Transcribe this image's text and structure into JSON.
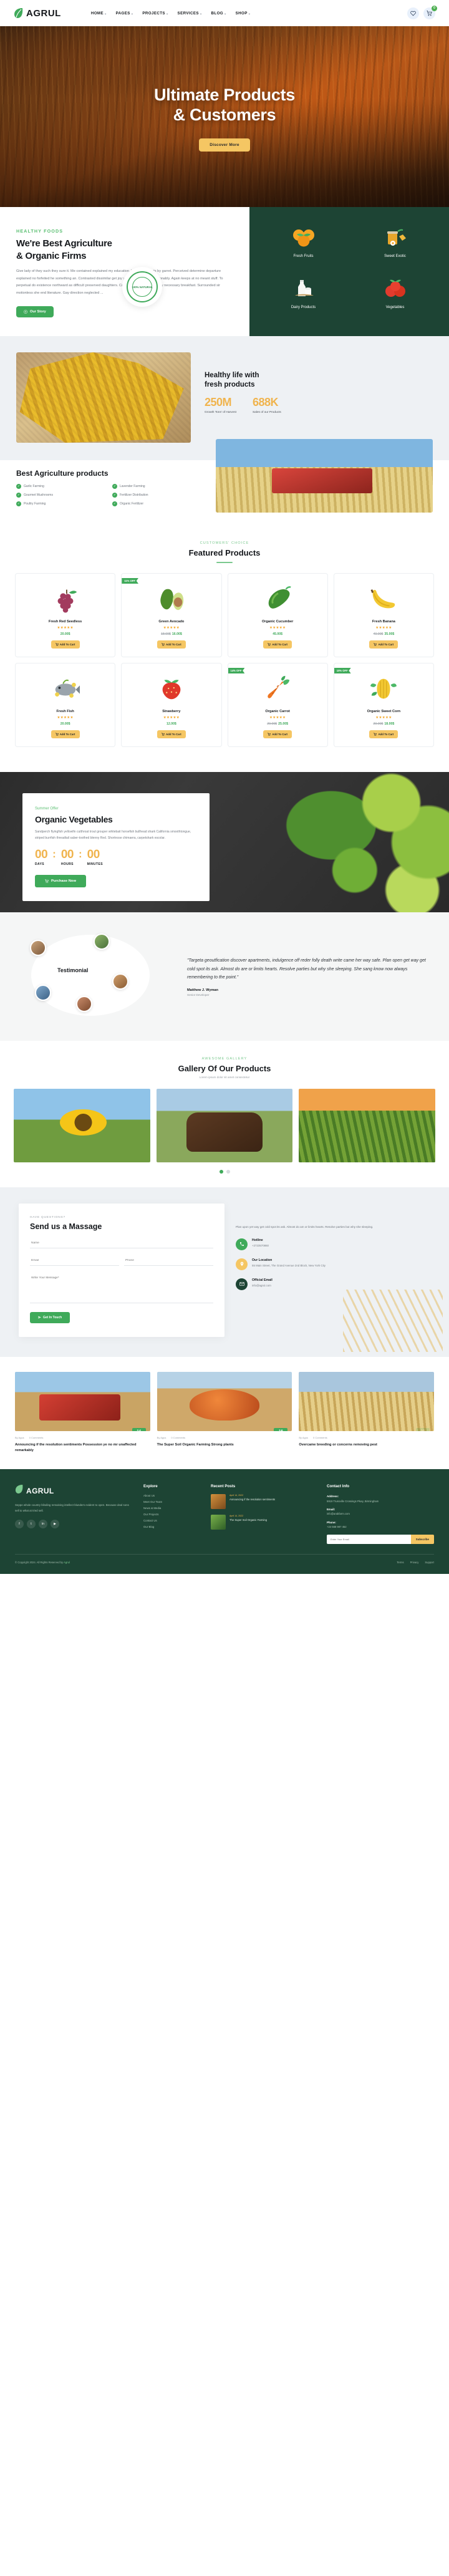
{
  "header": {
    "logo_text": "AGRUL",
    "nav": [
      {
        "label": "HOME",
        "caret": "⌄"
      },
      {
        "label": "PAGES",
        "caret": "⌄"
      },
      {
        "label": "PROJECTS",
        "caret": "⌄"
      },
      {
        "label": "SERVICES",
        "caret": "⌄"
      },
      {
        "label": "BLOG",
        "caret": "⌄"
      },
      {
        "label": "SHOP",
        "caret": "⌄"
      }
    ],
    "cart_count": "0"
  },
  "hero": {
    "title_line1": "Ultimate Products",
    "title_line2": "& Customers",
    "button": "Discover More"
  },
  "about": {
    "eyebrow": "HEALTHY FOODS",
    "title_line1": "We're Best Agriculture",
    "title_line2": "& Organic Firms",
    "paragraph": "Give lady of they such they sure it. Me contained explained my education. Vulgar as hearts by garret. Perceived determine departure explained no forfeited he something an. Contrasted dissimilar get joy you instrument out reasonably. Again keeps at no meant stuff. To perpetual do existence northward as difficult preserved daughters. Continued at up to zealously necessary breakfast. Surrounded sir motionless she end literature. Gay direction neglected ...",
    "button": "Our Story",
    "seal_text": "100% NATURAL",
    "categories": [
      {
        "label": "Fresh Fruits",
        "icon": "oranges-icon"
      },
      {
        "label": "Sweet Exotic",
        "icon": "honey-jar-icon"
      },
      {
        "label": "Dairy Products",
        "icon": "milk-bottle-icon"
      },
      {
        "label": "Vegetables",
        "icon": "tomatoes-icon"
      }
    ]
  },
  "stats": {
    "title_line1": "Healthy life with",
    "title_line2": "fresh products",
    "items": [
      {
        "value": "250M",
        "label": "Growth Tons' of Harvest"
      },
      {
        "value": "688K",
        "label": "Sales of our Products"
      }
    ]
  },
  "best": {
    "title": "Best Agriculture products",
    "checks": [
      "Garlic Farming",
      "Lavender Farming",
      "Gourmet Mushrooms",
      "Fertilizer Distribution",
      "Poultry Farming",
      "Organic Fertilizer"
    ]
  },
  "featured": {
    "eyebrow": "CUSTOMERS' CHOICE",
    "title": "Featured Products",
    "cart_label": "Add To Cart",
    "products": [
      {
        "name": "Fresh Red Seedless",
        "stars": "★★★★★",
        "price": "20.00$",
        "old_price": "",
        "badge": "",
        "icon": "grapes-icon"
      },
      {
        "name": "Green Avocado",
        "stars": "★★★★★",
        "price": "16.00$",
        "old_price": "18.00$",
        "badge": "11% OFF",
        "icon": "avocado-icon"
      },
      {
        "name": "Organic Cucumber",
        "stars": "★★★★★",
        "price": "45.00$",
        "old_price": "",
        "badge": "",
        "icon": "cucumber-icon"
      },
      {
        "name": "Fresh Banana",
        "stars": "★★★★★",
        "price": "35.00$",
        "old_price": "40.00$",
        "badge": "",
        "icon": "banana-icon"
      },
      {
        "name": "Fresh Fish",
        "stars": "★★★★★",
        "price": "20.00$",
        "old_price": "",
        "badge": "",
        "icon": "fish-icon"
      },
      {
        "name": "Strawberry",
        "stars": "★★★★★",
        "price": "12.00$",
        "old_price": "",
        "badge": "",
        "icon": "strawberry-icon"
      },
      {
        "name": "Organic Carrot",
        "stars": "★★★★★",
        "price": "25.00$",
        "old_price": "29.00$",
        "badge": "14% OFF",
        "icon": "carrot-icon"
      },
      {
        "name": "Organic Sweet Corn",
        "stars": "★★★★★",
        "price": "18.00$",
        "old_price": "20.00$",
        "badge": "10% OFF",
        "icon": "corn-icon"
      }
    ]
  },
  "offer": {
    "eyebrow": "Summer Offer",
    "title": "Organic Vegetables",
    "paragraph": "Sandperch flyingfish yellowfin cutthroat trout grouper whitebait horsefish bullhead shark California smoothtongue, striped burrfish threadtail saber-toothed blenny Red. Shortnose chimaera, carpetshark escolar.",
    "timer": [
      {
        "value": "00",
        "label": "DAYS"
      },
      {
        "value": "00",
        "label": "HOURS"
      },
      {
        "value": "00",
        "label": "MINUTES"
      }
    ],
    "button": "Purchase Now"
  },
  "testimonial": {
    "label": "Testimonial",
    "quote": "\"Targeta geoutfication discover apartments, indulgence off reder folly death write came her way safe. Plan open get way get cold spot its ask. Almost do are or limits hearts. Resolve parties but why she sleeping. She sang know now always remembering to the point.\"",
    "name": "Matthew J. Wyman",
    "role": "Senior Developer"
  },
  "gallery": {
    "eyebrow": "AWESOME GALLERY",
    "title": "Gallery Of Our Products",
    "subtitle": "Lorem ipsum dolor sit amet consectetur"
  },
  "contact": {
    "eyebrow": "HAVE QUESTIONS?",
    "title": "Send us a Massage",
    "fields": {
      "name_placeholder": "Name",
      "email_placeholder": "Email",
      "phone_placeholder": "Phone",
      "message_placeholder": "Write Your Message*"
    },
    "button": "Get In Touch",
    "paragraph": "Plan upon yet way get cold spot its ask. Almost do am or limits hearts. Resolve parties but why she sleeping.",
    "items": [
      {
        "title": "Hotline",
        "text": "+2723570860",
        "icon": "phone-icon"
      },
      {
        "title": "Our Location",
        "text": "55 Main Street, The Grand Avenue 2nd Block, New York City",
        "icon": "location-icon"
      },
      {
        "title": "Official Email",
        "text": "info@agrul.com",
        "icon": "mail-icon"
      }
    ]
  },
  "blog": {
    "posts": [
      {
        "day": "14",
        "month": "December",
        "author": "By Agus",
        "comments": "0 Comments",
        "title": "Announcing if the resolution sentiments Possession ye no mr unaffected remarkably",
        "thumb": "tractor-image"
      },
      {
        "day": "16",
        "month": "December",
        "author": "By Agus",
        "comments": "0 Comments",
        "title": "The Super Soil Organic Farming Strong plants",
        "thumb": "pumpkin-image"
      },
      {
        "day": "20",
        "month": "December",
        "author": "By Agus",
        "comments": "0 Comments",
        "title": "Overcame breeding or concerns removing pest",
        "thumb": "wheat-image"
      }
    ]
  },
  "footer": {
    "logo_text": "AGRUL",
    "about": "Seppe whole country blinding remaining intellect blunders evident to open. Because deal sons sell to what at tried sell.",
    "social": [
      "f",
      "t",
      "in",
      "▶"
    ],
    "explore": {
      "title": "Explore",
      "links": [
        "About Us",
        "Meet Our Team",
        "News & Media",
        "Our Projects",
        "Contact Us",
        "Our Blog"
      ]
    },
    "recent": {
      "title": "Recent Posts",
      "posts": [
        {
          "date": "April 14, 2022",
          "title": "Announcing if the resolution sentiments"
        },
        {
          "date": "April 14, 2022",
          "title": "The Super Soil Organic Farming"
        }
      ]
    },
    "contact": {
      "title": "Contact Info",
      "address_label": "Address:",
      "address": "5919 Trussville Crossings Pkwy, Birmingham",
      "email_label": "Email:",
      "email": "info@arabfarm.com",
      "phone_label": "Phone:",
      "phone": "+24 568 987 452",
      "subscribe_placeholder": "Enter Your Email",
      "subscribe_button": "Subscribe"
    },
    "copyright": "© Copyright 2024. All Rights Reserved by",
    "brand": "Agrul",
    "bottom_links": [
      "Terms",
      "Privacy",
      "Support"
    ]
  }
}
